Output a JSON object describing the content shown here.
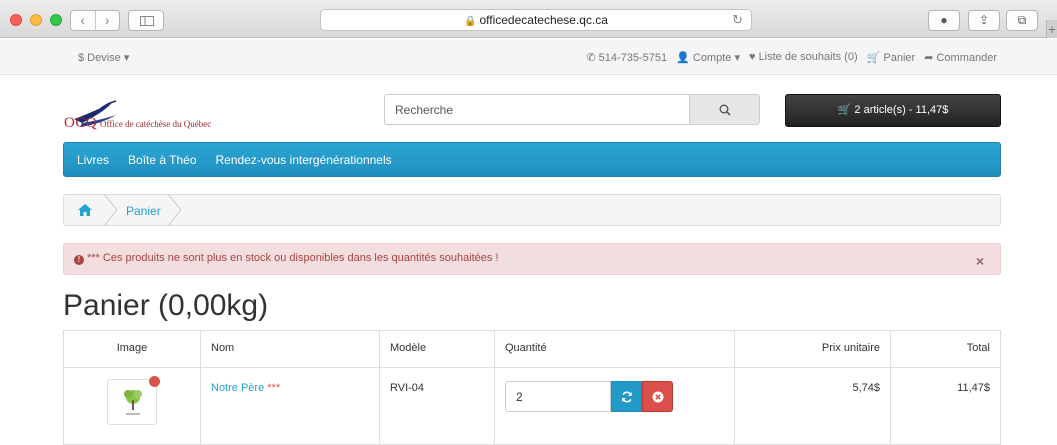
{
  "browser": {
    "url": "officedecatechese.qc.ca",
    "colors": {
      "close": "#fc605c",
      "minimize": "#fdbc40",
      "zoom": "#34c84a"
    }
  },
  "topbar": {
    "currency": "$ Devise ▾",
    "phone": "514-735-5751",
    "account": "Compte ▾",
    "wishlist": "Liste de souhaits (0)",
    "cart": "Panier",
    "checkout": "Commander"
  },
  "header": {
    "logo_text": "OCQ",
    "logo_subtitle": "Office de catéchèse du Québec",
    "search_placeholder": "Recherche",
    "cart_button": "2 article(s) - 11,47$"
  },
  "menu": {
    "items": [
      "Livres",
      "Boîte à Théo",
      "Rendez-vous intergénérationnels"
    ],
    "color": "#2ba6d3"
  },
  "breadcrumb": {
    "current": "Panier"
  },
  "alert": {
    "text": "*** Ces produits ne sont plus en stock ou disponibles dans les quantités souhaitées !",
    "close": "×",
    "color": "#f2dede"
  },
  "page": {
    "title": "Panier  (0,00kg)"
  },
  "table": {
    "headers": {
      "image": "Image",
      "name": "Nom",
      "model": "Modèle",
      "quantity": "Quantité",
      "unit_price": "Prix unitaire",
      "total": "Total"
    },
    "rows": [
      {
        "name": "Notre Père",
        "stock_flag": "***",
        "model": "RVI-04",
        "quantity": "2",
        "unit_price": "5,74$",
        "total": "11,47$"
      }
    ]
  }
}
